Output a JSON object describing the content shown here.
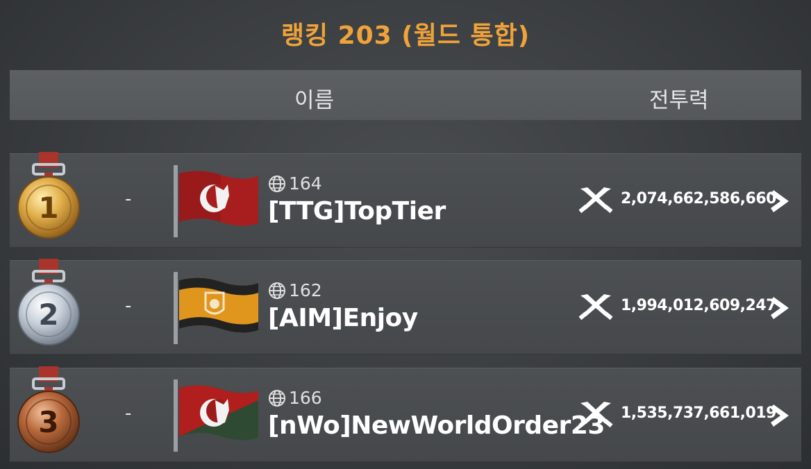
{
  "title": "랭킹 203 (월드 통합)",
  "header": {
    "name_label": "이름",
    "power_label": "전투력"
  },
  "rows": [
    {
      "rank": "1",
      "change": "-",
      "server": "164",
      "name": "[TTG]TopTier",
      "power": "2,074,662,586,660",
      "medal": "gold",
      "flag": "wolf-crescent-red"
    },
    {
      "rank": "2",
      "change": "-",
      "server": "162",
      "name": "[AIM]Enjoy",
      "power": "1,994,012,609,247",
      "medal": "silver",
      "flag": "bear-shield-orange"
    },
    {
      "rank": "3",
      "change": "-",
      "server": "166",
      "name": "[nWo]NewWorldOrder23",
      "power": "1,535,737,661,019",
      "medal": "bronze",
      "flag": "wolf-crescent-red-green"
    }
  ],
  "colors": {
    "title": "#f0a33a",
    "gold": "#d9a441",
    "silver": "#c9d2dc",
    "bronze": "#b86a3f",
    "ribbon": "#a8342c"
  },
  "icons": {
    "server": "globe-icon",
    "power": "crossed-swords-icon",
    "more": "chevron-right-icon"
  }
}
